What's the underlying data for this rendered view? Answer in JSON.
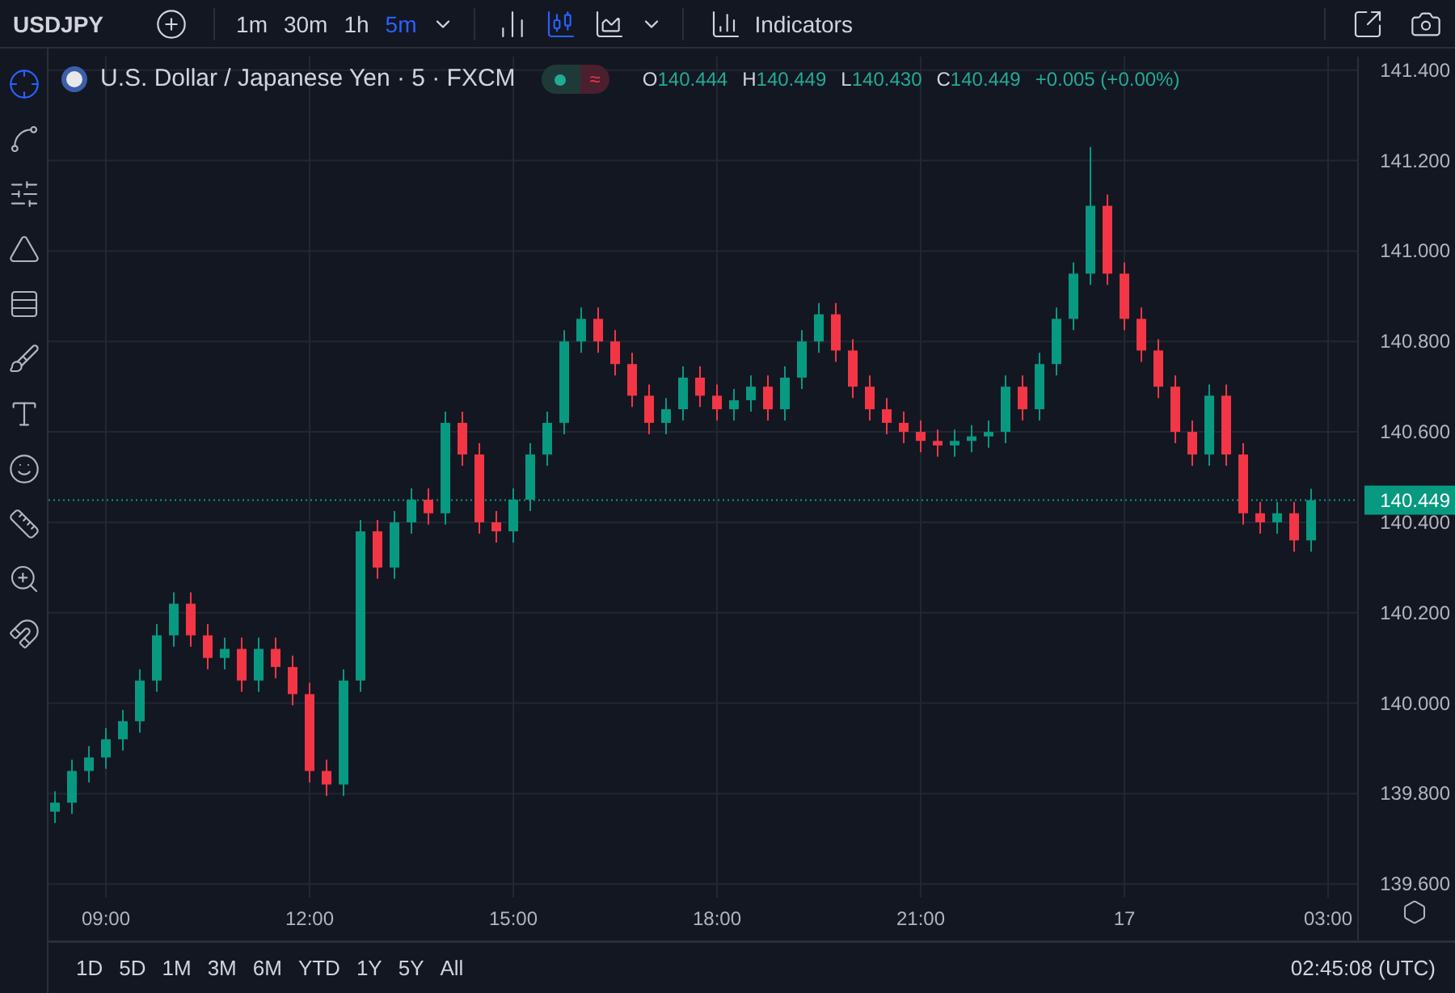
{
  "toolbar": {
    "symbol": "USDJPY",
    "intervals": [
      {
        "label": "1m",
        "selected": false
      },
      {
        "label": "30m",
        "selected": false
      },
      {
        "label": "1h",
        "selected": false
      },
      {
        "label": "5m",
        "selected": true
      }
    ],
    "chart_types": [
      {
        "kind": "bars",
        "selected": false
      },
      {
        "kind": "candles",
        "selected": true
      },
      {
        "kind": "area",
        "selected": false
      }
    ],
    "indicators_label": "Indicators"
  },
  "tools": [
    {
      "kind": "crosshair",
      "selected": true
    },
    {
      "kind": "trend-line",
      "selected": false
    },
    {
      "kind": "fib",
      "selected": false
    },
    {
      "kind": "pattern",
      "selected": false
    },
    {
      "kind": "prediction",
      "selected": false
    },
    {
      "kind": "brush",
      "selected": false
    },
    {
      "kind": "text",
      "selected": false
    },
    {
      "kind": "emoji",
      "selected": false
    },
    {
      "kind": "ruler",
      "selected": false
    },
    {
      "kind": "zoom",
      "selected": false
    },
    {
      "kind": "magnet",
      "selected": false
    }
  ],
  "legend": {
    "title": "U.S. Dollar / Japanese Yen · 5 · FXCM",
    "status_badge": "≈",
    "ohlc": [
      {
        "label": "O",
        "value": "140.444"
      },
      {
        "label": "H",
        "value": "140.449"
      },
      {
        "label": "L",
        "value": "140.430"
      },
      {
        "label": "C",
        "value": "140.449"
      }
    ],
    "change": "+0.005 (+0.00%)"
  },
  "chart": {
    "chart_data": {
      "type": "candlestick",
      "grid": true,
      "categories": [
        null,
        null,
        null,
        "09:00",
        null,
        null,
        null,
        null,
        null,
        null,
        null,
        null,
        null,
        null,
        null,
        "12:00",
        null,
        null,
        null,
        null,
        null,
        null,
        null,
        null,
        null,
        null,
        null,
        "15:00",
        null,
        null,
        null,
        null,
        null,
        null,
        null,
        null,
        null,
        null,
        null,
        "18:00",
        null,
        null,
        null,
        null,
        null,
        null,
        null,
        null,
        null,
        null,
        null,
        "21:00",
        null,
        null,
        null,
        null,
        null,
        null,
        null,
        null,
        null,
        null,
        null,
        "17",
        null,
        null,
        null,
        null,
        null,
        null,
        null,
        null,
        null,
        null,
        null,
        "03:00"
      ],
      "ohlc": [
        [
          139.76,
          139.805,
          139.735,
          139.78
        ],
        [
          139.78,
          139.875,
          139.755,
          139.85
        ],
        [
          139.85,
          139.905,
          139.825,
          139.88
        ],
        [
          139.88,
          139.945,
          139.855,
          139.92
        ],
        [
          139.92,
          139.985,
          139.895,
          139.96
        ],
        [
          139.96,
          140.075,
          139.935,
          140.05
        ],
        [
          140.05,
          140.175,
          140.025,
          140.15
        ],
        [
          140.15,
          140.245,
          140.125,
          140.22
        ],
        [
          140.22,
          140.245,
          140.125,
          140.15
        ],
        [
          140.15,
          140.175,
          140.075,
          140.1
        ],
        [
          140.1,
          140.145,
          140.075,
          140.12
        ],
        [
          140.12,
          140.145,
          140.025,
          140.05
        ],
        [
          140.05,
          140.145,
          140.025,
          140.12
        ],
        [
          140.12,
          140.145,
          140.055,
          140.08
        ],
        [
          140.08,
          140.105,
          139.995,
          140.02
        ],
        [
          140.02,
          140.045,
          139.825,
          139.85
        ],
        [
          139.85,
          139.875,
          139.795,
          139.82
        ],
        [
          139.82,
          140.075,
          139.795,
          140.05
        ],
        [
          140.05,
          140.405,
          140.025,
          140.38
        ],
        [
          140.38,
          140.405,
          140.275,
          140.3
        ],
        [
          140.3,
          140.425,
          140.275,
          140.4
        ],
        [
          140.4,
          140.475,
          140.375,
          140.45
        ],
        [
          140.45,
          140.475,
          140.395,
          140.42
        ],
        [
          140.42,
          140.645,
          140.395,
          140.62
        ],
        [
          140.62,
          140.645,
          140.525,
          140.55
        ],
        [
          140.55,
          140.575,
          140.375,
          140.4
        ],
        [
          140.4,
          140.425,
          140.355,
          140.38
        ],
        [
          140.38,
          140.475,
          140.355,
          140.45
        ],
        [
          140.45,
          140.575,
          140.425,
          140.55
        ],
        [
          140.55,
          140.645,
          140.525,
          140.62
        ],
        [
          140.62,
          140.825,
          140.595,
          140.8
        ],
        [
          140.8,
          140.875,
          140.775,
          140.85
        ],
        [
          140.85,
          140.875,
          140.775,
          140.8
        ],
        [
          140.8,
          140.825,
          140.725,
          140.75
        ],
        [
          140.75,
          140.775,
          140.655,
          140.68
        ],
        [
          140.68,
          140.705,
          140.595,
          140.62
        ],
        [
          140.62,
          140.675,
          140.595,
          140.65
        ],
        [
          140.65,
          140.745,
          140.625,
          140.72
        ],
        [
          140.72,
          140.745,
          140.655,
          140.68
        ],
        [
          140.68,
          140.705,
          140.625,
          140.65
        ],
        [
          140.65,
          140.695,
          140.625,
          140.67
        ],
        [
          140.67,
          140.725,
          140.645,
          140.7
        ],
        [
          140.7,
          140.725,
          140.625,
          140.65
        ],
        [
          140.65,
          140.745,
          140.625,
          140.72
        ],
        [
          140.72,
          140.825,
          140.695,
          140.8
        ],
        [
          140.8,
          140.885,
          140.775,
          140.86
        ],
        [
          140.86,
          140.885,
          140.755,
          140.78
        ],
        [
          140.78,
          140.805,
          140.675,
          140.7
        ],
        [
          140.7,
          140.725,
          140.625,
          140.65
        ],
        [
          140.65,
          140.675,
          140.595,
          140.62
        ],
        [
          140.62,
          140.645,
          140.575,
          140.6
        ],
        [
          140.6,
          140.625,
          140.555,
          140.58
        ],
        [
          140.58,
          140.605,
          140.545,
          140.57
        ],
        [
          140.57,
          140.605,
          140.545,
          140.58
        ],
        [
          140.58,
          140.615,
          140.555,
          140.59
        ],
        [
          140.59,
          140.625,
          140.565,
          140.6
        ],
        [
          140.6,
          140.725,
          140.575,
          140.7
        ],
        [
          140.7,
          140.725,
          140.625,
          140.65
        ],
        [
          140.65,
          140.775,
          140.625,
          140.75
        ],
        [
          140.75,
          140.875,
          140.725,
          140.85
        ],
        [
          140.85,
          140.975,
          140.825,
          140.95
        ],
        [
          140.95,
          141.23,
          140.925,
          141.1
        ],
        [
          141.1,
          141.125,
          140.925,
          140.95
        ],
        [
          140.95,
          140.975,
          140.825,
          140.85
        ],
        [
          140.85,
          140.875,
          140.755,
          140.78
        ],
        [
          140.78,
          140.805,
          140.675,
          140.7
        ],
        [
          140.7,
          140.725,
          140.575,
          140.6
        ],
        [
          140.6,
          140.625,
          140.525,
          140.55
        ],
        [
          140.55,
          140.705,
          140.525,
          140.68
        ],
        [
          140.68,
          140.705,
          140.525,
          140.55
        ],
        [
          140.55,
          140.575,
          140.395,
          140.42
        ],
        [
          140.42,
          140.445,
          140.375,
          140.4
        ],
        [
          140.4,
          140.445,
          140.375,
          140.42
        ],
        [
          140.42,
          140.445,
          140.335,
          140.36
        ],
        [
          140.36,
          140.474,
          140.335,
          140.449
        ],
        null
      ],
      "ref_lines": [
        {
          "axis": "y",
          "value": 140.449,
          "label": "140.449",
          "color": "#089981",
          "line_style": "dotted"
        }
      ],
      "ylim": [
        139.57,
        141.43
      ],
      "yticks": [
        {
          "value": 141.4,
          "label": "141.400"
        },
        {
          "value": 141.2,
          "label": "141.200"
        },
        {
          "value": 141.0,
          "label": "141.000"
        },
        {
          "value": 140.8,
          "label": "140.800"
        },
        {
          "value": 140.6,
          "label": "140.600"
        },
        {
          "value": 140.4,
          "label": "140.400"
        },
        {
          "value": 140.2,
          "label": "140.200"
        },
        {
          "value": 140.0,
          "label": "140.000"
        },
        {
          "value": 139.8,
          "label": "139.800"
        },
        {
          "value": 139.6,
          "label": "139.600"
        }
      ]
    }
  },
  "ranges": [
    "1D",
    "5D",
    "1M",
    "3M",
    "6M",
    "YTD",
    "1Y",
    "5Y",
    "All"
  ],
  "clock": "02:45:08 (UTC)"
}
